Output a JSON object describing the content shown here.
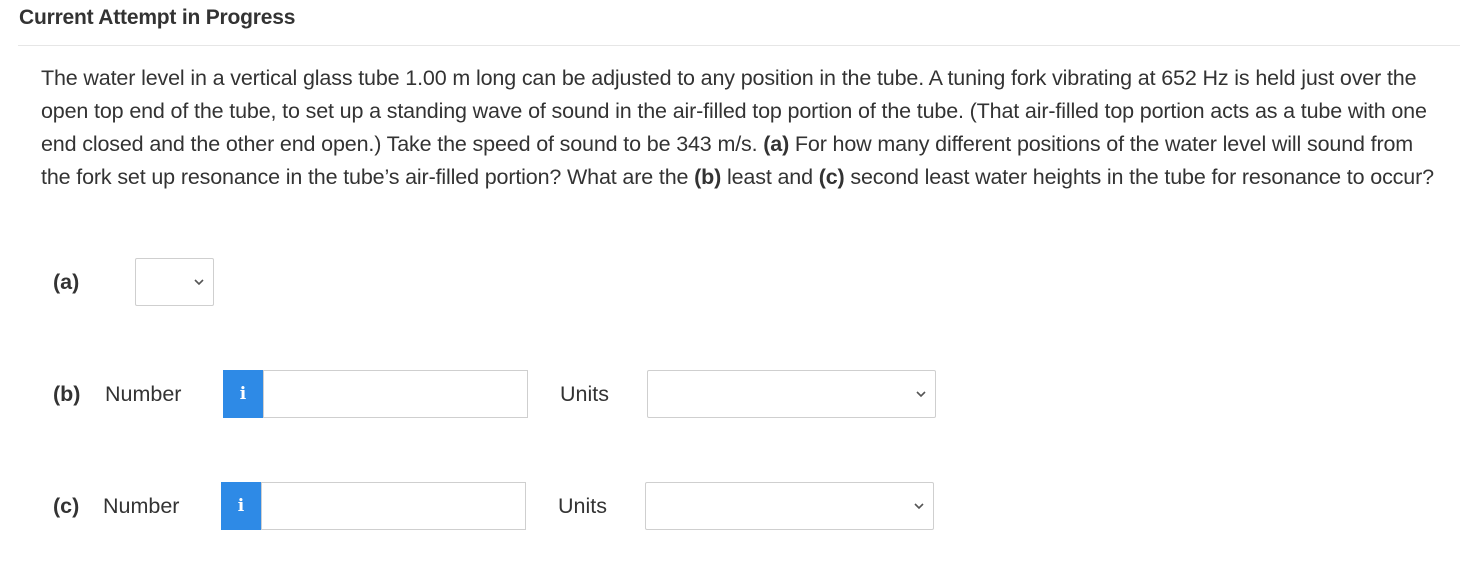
{
  "header": {
    "title": "Current Attempt in Progress"
  },
  "question": {
    "segments": [
      {
        "text": "The water level in a vertical glass tube 1.00 m long can be adjusted to any position in the tube. A tuning fork vibrating at 652 Hz is held just over the open top end of the tube, to set up a standing wave of sound in the air-filled top portion of the tube. (That air-filled top portion acts as a tube with one end closed and the other end open.) Take the speed of sound to be 343 m/s. ",
        "bold": false
      },
      {
        "text": "(a)",
        "bold": true
      },
      {
        "text": " For how many different positions of the water level will sound from the fork set up resonance in the tube’s air-filled portion? What are the ",
        "bold": false
      },
      {
        "text": "(b)",
        "bold": true
      },
      {
        "text": " least and ",
        "bold": false
      },
      {
        "text": "(c)",
        "bold": true
      },
      {
        "text": " second least water heights in the tube for resonance to occur?",
        "bold": false
      }
    ]
  },
  "part_a": {
    "label": "(a)",
    "selected_value": ""
  },
  "part_b": {
    "label": "(b)",
    "number_label": "Number",
    "info_icon": "i",
    "number_value": "",
    "units_label": "Units",
    "units_value": ""
  },
  "part_c": {
    "label": "(c)",
    "number_label": "Number",
    "info_icon": "i",
    "number_value": "",
    "units_label": "Units",
    "units_value": ""
  },
  "colors": {
    "info_button": "#2e8ae6",
    "text": "#333333",
    "border": "#cfcfcf"
  },
  "icons": {
    "dropdown": "chevron-down-icon",
    "info": "info-icon"
  }
}
